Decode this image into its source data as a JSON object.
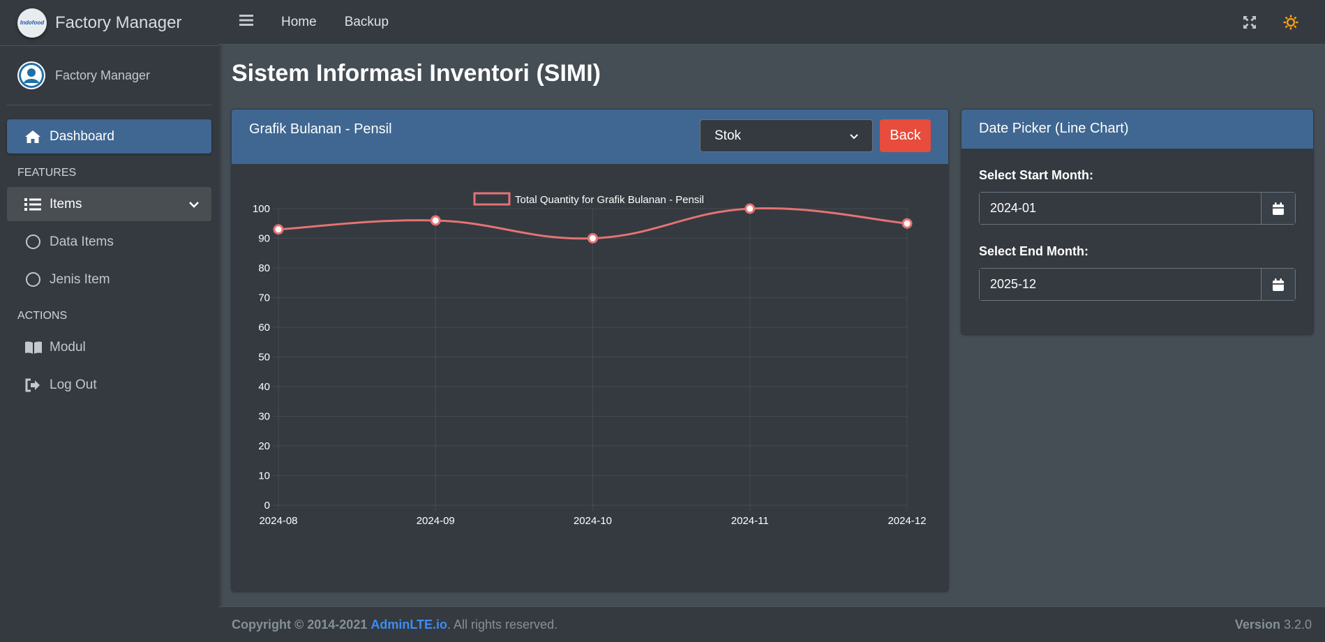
{
  "brand": {
    "name": "Factory Manager",
    "logo_text": "Indofood"
  },
  "user": {
    "name": "Factory Manager"
  },
  "sidebar": {
    "dashboard": "Dashboard",
    "features_header": "FEATURES",
    "items": "Items",
    "data_items": "Data Items",
    "jenis_item": "Jenis Item",
    "actions_header": "ACTIONS",
    "modul": "Modul",
    "logout": "Log Out"
  },
  "topnav": {
    "home": "Home",
    "backup": "Backup"
  },
  "page": {
    "title": "Sistem Informasi Inventori (SIMI)"
  },
  "chart_card": {
    "title": "Grafik Bulanan - Pensil",
    "selected_metric": "Stok",
    "back_label": "Back"
  },
  "date_picker": {
    "title": "Date Picker (Line Chart)",
    "start_label": "Select Start Month:",
    "start_value": "2024-01",
    "end_label": "Select End Month:",
    "end_value": "2025-12"
  },
  "footer": {
    "copyright_prefix": "Copyright © 2014-2021",
    "link": "AdminLTE.io",
    "suffix": ". All rights reserved.",
    "version_label": "Version",
    "version": "3.2.0"
  },
  "colors": {
    "accent": "#3f6791",
    "danger": "#e74c3c",
    "line": "#e57373",
    "sun": "#f39c12"
  },
  "chart_data": {
    "type": "line",
    "title": "",
    "categories": [
      "2024-08",
      "2024-09",
      "2024-10",
      "2024-11",
      "2024-12"
    ],
    "series": [
      {
        "name": "Total Quantity for Grafik Bulanan - Pensil",
        "values": [
          93,
          96,
          90,
          100,
          95
        ]
      }
    ],
    "ylim": [
      0,
      100
    ],
    "yticks": [
      0,
      10,
      20,
      30,
      40,
      50,
      60,
      70,
      80,
      90,
      100
    ],
    "grid": true,
    "legend": "top-center"
  }
}
